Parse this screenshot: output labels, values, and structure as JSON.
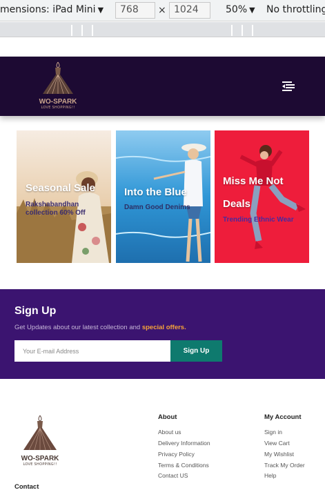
{
  "devtools": {
    "device_label": "mensions: iPad Mini",
    "width": "768",
    "times": "×",
    "height": "1024",
    "zoom": "50%",
    "throttle": "No throttling"
  },
  "header": {
    "logo_brand": "WO-SPARK",
    "logo_tagline": "LOVE SHOPPING!!",
    "menu_icon": "hamburger-menu-icon"
  },
  "promos": [
    {
      "title": "Seasonal Sale",
      "subtitle": "Rakshabandhan collection 60% Off",
      "subtitle_color": "#3b2d6e"
    },
    {
      "title": "Into the Blue",
      "subtitle": "Damn Good Denims",
      "subtitle_color": "#2c2f66"
    },
    {
      "title_line1": "Miss Me Not",
      "title_line2": "Deals",
      "subtitle": "Trending Ethnic Wear",
      "subtitle_color": "#4a2a9e"
    }
  ],
  "signup": {
    "heading": "Sign Up",
    "text_before": "Get Updates about our latest collection and",
    "text_highlight": "special offers.",
    "placeholder": "Your E-mail Address",
    "button": "Sign Up"
  },
  "footer": {
    "logo_brand": "WO-SPARK",
    "logo_tagline": "LOVE SHOPPING!!",
    "about_heading": "About",
    "about_links": [
      "About us",
      "Delivery Information",
      "Privacy Policy",
      "Terms & Conditions",
      "Contact US"
    ],
    "account_heading": "My Account",
    "account_links": [
      "Sign in",
      "View Cart",
      "My Wishlist",
      "Track My Order",
      "Help"
    ],
    "contact_heading": "Contact"
  },
  "colors": {
    "header_bg": "#1d0a33",
    "signup_bg": "#3b1470",
    "accent_orange": "#f6a33a",
    "button_teal": "#0e7a6e"
  }
}
